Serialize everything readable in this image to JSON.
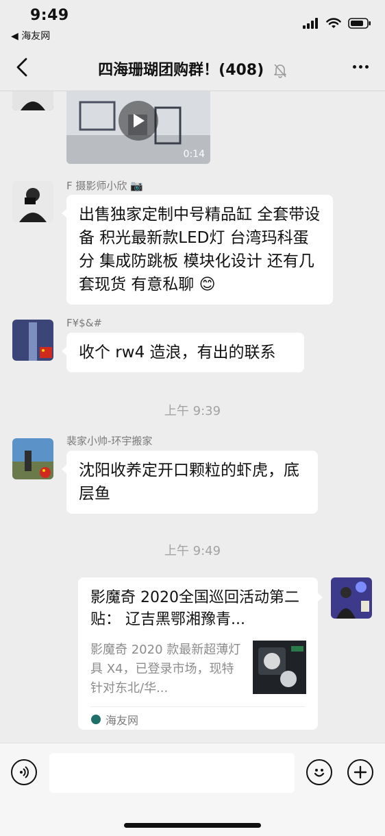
{
  "status_bar": {
    "time": "9:49",
    "back_app": "◀ 海友网"
  },
  "nav": {
    "title": "四海珊瑚团购群！(408)"
  },
  "messages": [
    {
      "type": "video",
      "duration": "0:14"
    },
    {
      "sender": "F 摄影师小欣 📷",
      "text": "出售独家定制中号精品缸 全套带设备 积光最新款LED灯 台湾玛科蛋分 集成防跳板 模块化设计 还有几套现货 有意私聊 😊"
    },
    {
      "sender": "F¥$&#",
      "text": "收个 rw4 造浪，有出的联系"
    },
    {
      "time_divider": "上午 9:39"
    },
    {
      "sender": "裴家小帅-环宇搬家",
      "text": "沈阳收养定开口颗粒的虾虎，底层鱼"
    },
    {
      "time_divider": "上午 9:49"
    },
    {
      "type": "link",
      "title": "影魔奇 2020全国巡回活动第二贴： 辽吉黑鄂湘豫青...",
      "description": "影魔奇 2020 款最新超薄灯具 X4，已登录市场，现特针对东北/华...",
      "source": "海友网"
    }
  ],
  "colors": {
    "background": "#ededed",
    "bubble": "#ffffff",
    "meta_text": "#7a7a7a",
    "source_icon": "#1f6f6a"
  }
}
